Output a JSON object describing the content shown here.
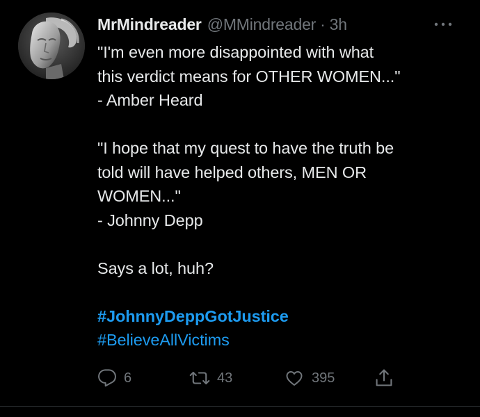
{
  "tweet": {
    "display_name": "MrMindreader",
    "handle": "@MMindreader",
    "separator": "·",
    "time": "3h",
    "more_icon": "more-horizontal-icon",
    "avatar_icon": "statue-avatar",
    "body_lines": [
      "\"I'm even more disappointed with what",
      "this verdict means for OTHER WOMEN...\"",
      "- Amber Heard",
      "",
      "\"I hope that my quest to have the truth be",
      "told will have helped others, MEN OR",
      "WOMEN...\"",
      "- Johnny Depp",
      "",
      "Says a lot, huh?",
      ""
    ],
    "hashtags": [
      "#JohnnyDeppGotJustice",
      "#BelieveAllVictims"
    ],
    "actions": {
      "reply": {
        "icon": "reply-icon",
        "count": "6"
      },
      "retweet": {
        "icon": "retweet-icon",
        "count": "43"
      },
      "like": {
        "icon": "heart-icon",
        "count": "395"
      },
      "share": {
        "icon": "share-icon"
      }
    }
  },
  "colors": {
    "background": "#000000",
    "text": "#e7e9ea",
    "secondary": "#71767b",
    "link": "#1d9bf0"
  }
}
